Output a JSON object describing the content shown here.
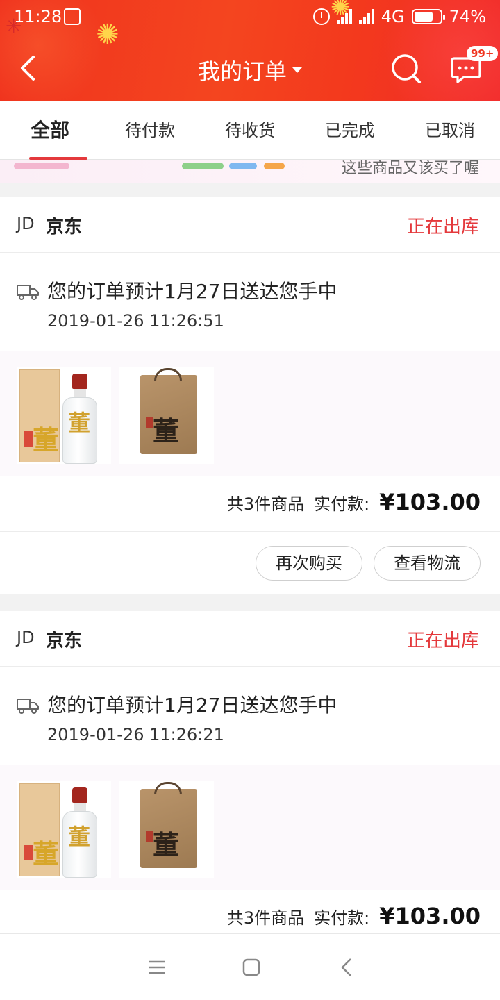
{
  "status_bar": {
    "time": "11:28",
    "network": "4G",
    "battery": "74%",
    "battery_level": 0.74
  },
  "header": {
    "title": "我的订单",
    "back_icon": "chevron-left-icon",
    "search_icon": "search-icon",
    "message_icon": "message-icon",
    "message_badge": "99+",
    "accent_color": "#f0331e"
  },
  "tabs": [
    {
      "label": "全部",
      "active": true
    },
    {
      "label": "待付款",
      "active": false
    },
    {
      "label": "待收货",
      "active": false
    },
    {
      "label": "已完成",
      "active": false
    },
    {
      "label": "已取消",
      "active": false
    }
  ],
  "banner": {
    "text": "这些商品又该买了喔"
  },
  "orders": [
    {
      "shop_logo": "JD",
      "shop": "京东",
      "status": "正在出库",
      "logistics_icon": "truck-icon",
      "logistics_msg": "您的订单预计1月27日送达您手中",
      "logistics_time": "2019-01-26 11:26:51",
      "item_count": "共3件商品",
      "paid_label": "实付款:",
      "price": "¥103.00",
      "actions": [
        "再次购买",
        "查看物流"
      ]
    },
    {
      "shop_logo": "JD",
      "shop": "京东",
      "status": "正在出库",
      "logistics_icon": "truck-icon",
      "logistics_msg": "您的订单预计1月27日送达您手中",
      "logistics_time": "2019-01-26 11:26:21",
      "item_count": "共3件商品",
      "paid_label": "实付款:",
      "price": "¥103.00"
    }
  ],
  "product_images": {
    "bottle_char": "董",
    "bag_char": "董"
  },
  "system_nav": [
    "menu-icon",
    "home-square-icon",
    "back-triangle-icon"
  ],
  "colors": {
    "status_red": "#e4393c",
    "tab_indicator": "#e4393c"
  }
}
